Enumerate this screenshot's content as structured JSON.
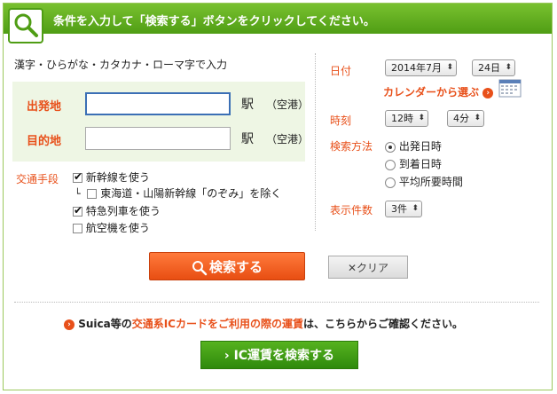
{
  "header": {
    "title": "条件を入力して「検索する」ボタンをクリックしてください。"
  },
  "left": {
    "hint": "漢字・ひらがな・カタカナ・ローマ字で入力",
    "departure_label": "出発地",
    "destination_label": "目的地",
    "eki": "駅",
    "kuko": "（空港）",
    "departure_value": "",
    "destination_value": "",
    "transport_label": "交通手段",
    "options": [
      {
        "label": "新幹線を使う",
        "checked": true
      },
      {
        "label": "東海道・山陽新幹線「のぞみ」を除く",
        "checked": false
      },
      {
        "label": "特急列車を使う",
        "checked": true
      },
      {
        "label": "航空機を使う",
        "checked": false
      }
    ]
  },
  "right": {
    "date_label": "日付",
    "month_value": "2014年7月",
    "day_value": "24日",
    "calendar_link": "カレンダーから選ぶ",
    "time_label": "時刻",
    "hour_value": "12時",
    "minute_value": "4分",
    "method_label": "検索方法",
    "methods": [
      {
        "label": "出発日時",
        "selected": true
      },
      {
        "label": "到着日時",
        "selected": false
      },
      {
        "label": "平均所要時間",
        "selected": false
      }
    ],
    "count_label": "表示件数",
    "count_value": "3件"
  },
  "buttons": {
    "search": "検索する",
    "clear": "クリア",
    "ic": "IC運賃を検索する"
  },
  "notice": {
    "part1": "Suica等の",
    "part2": "交通系ICカードをご利用の際の運賃",
    "part3": "は、こちらからご確認ください。"
  },
  "colors": {
    "accent_orange": "#e8501a",
    "header_green": "#5aa81c"
  }
}
